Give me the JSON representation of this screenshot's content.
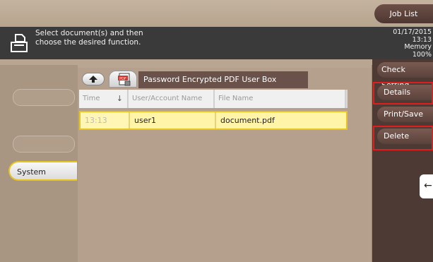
{
  "header": {
    "job_list_label": "Job List",
    "message": "Select document(s) and then\nchoose the desired function.",
    "status": "01/17/2015\n13:13\nMemory\n100%"
  },
  "left_nav": {
    "system_label": "System"
  },
  "box": {
    "title": "Password Encrypted PDF User Box",
    "pdf_badge": "PDF"
  },
  "table": {
    "columns": [
      "Time",
      "User/Account Name",
      "File Name"
    ],
    "rows": [
      {
        "time": "13:13",
        "user": "user1",
        "file": "document.pdf"
      }
    ]
  },
  "right_menu": {
    "check_setting": "Check Setting",
    "details": "Details",
    "print_save": "Print/Save",
    "delete": "Delete"
  },
  "colors": {
    "highlight": "#e01e1e",
    "selection": "#e7c41f",
    "brand_brown": "#5a423b"
  }
}
